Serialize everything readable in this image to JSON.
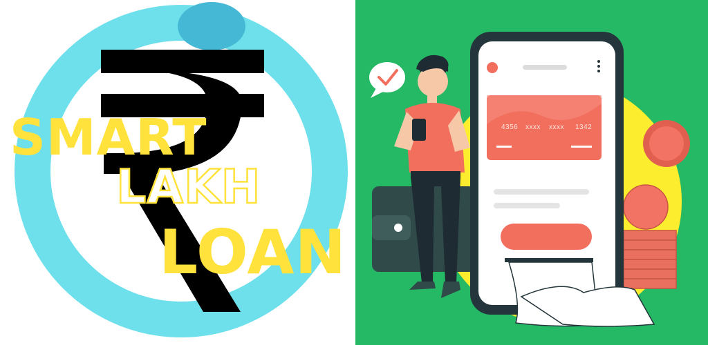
{
  "brand": {
    "word1": "SMART",
    "word2": "LAKH",
    "word3": "LOAN",
    "currency_symbol": "rupee-sign"
  },
  "card": {
    "group1": "4356",
    "group2": "xxxx",
    "group3": "xxxx",
    "group4": "1342"
  },
  "colors": {
    "ring": "#6de0ec",
    "ring_knob": "#45b8d6",
    "brand_yellow": "#ffe23c",
    "rupee": "#000000",
    "panel_green": "#25b865",
    "accent_coral": "#f26f5e",
    "backdrop_yellow": "#fcee2f"
  },
  "icons": [
    "rupee-sign-icon",
    "check-bubble-icon",
    "more-vert-icon",
    "wallet-icon",
    "coin-icon",
    "receipt-icon"
  ]
}
